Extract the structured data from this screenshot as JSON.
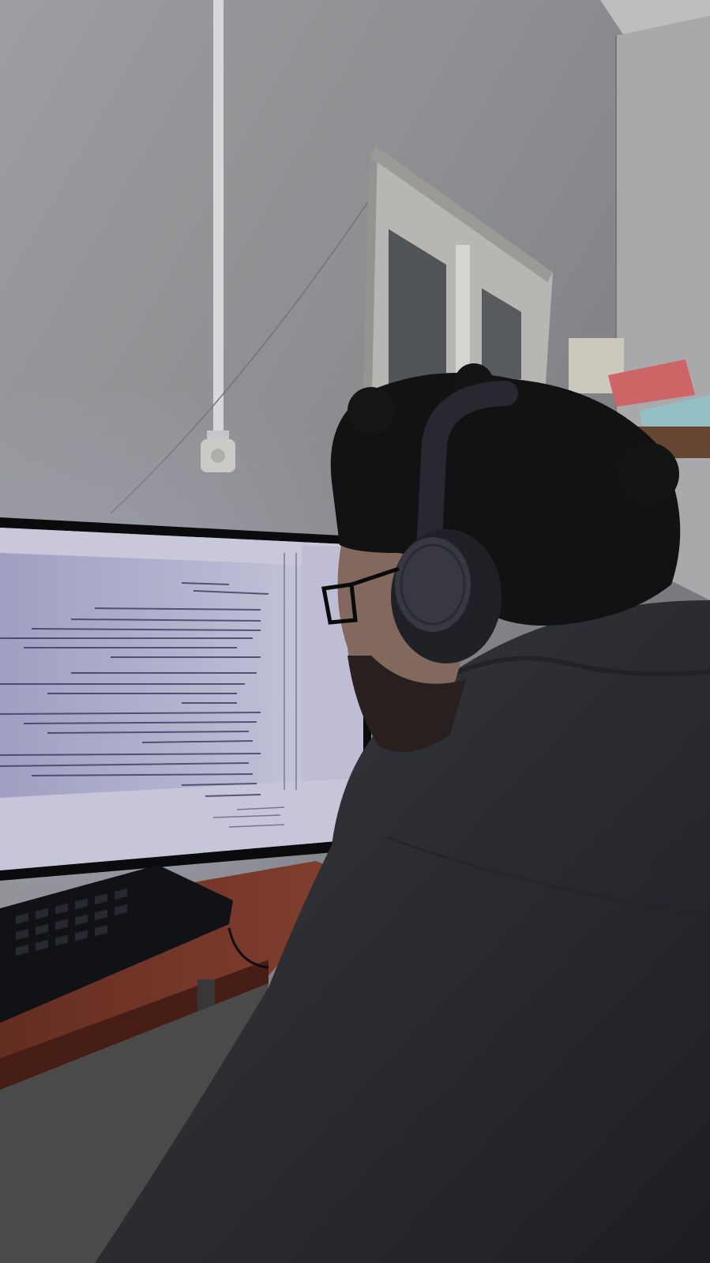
{
  "scene": {
    "description_free": true,
    "colors": {
      "wall": "#9a9a9e",
      "window_frame": "#d6d4d2",
      "window_glass": "#575a5c",
      "monitor_bezel": "#0c0c0f",
      "screen_bg": "#b9b8d6",
      "code_text": "#2a2a48",
      "desk": "#7a3a2a",
      "keyboard": "#121317",
      "hoodie": "#2e3034",
      "hair": "#151414",
      "headphones": "#2b2c33",
      "cloth_pink": "#d96a6c"
    },
    "objects": [
      "pipe",
      "wall-socket",
      "window",
      "shelf",
      "monitor",
      "code-editor-screen",
      "keyboard",
      "desk",
      "person",
      "headphones",
      "glasses"
    ]
  }
}
